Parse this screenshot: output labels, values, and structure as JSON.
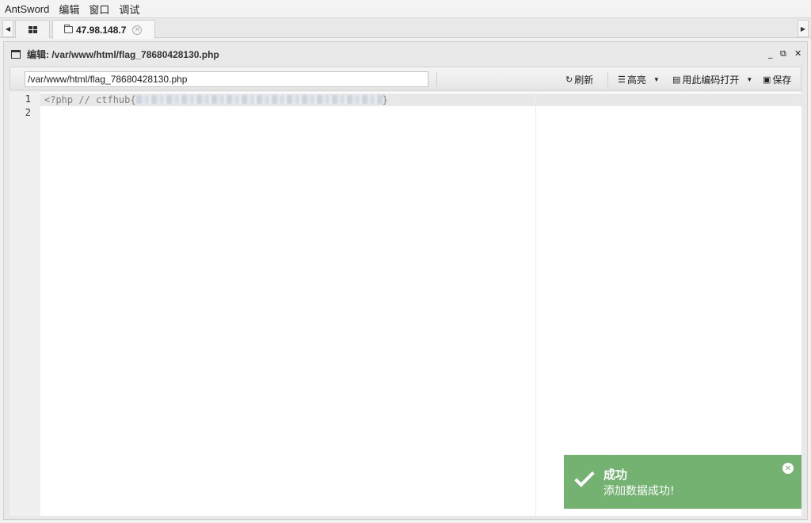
{
  "menubar": {
    "items": [
      "AntSword",
      "编辑",
      "窗口",
      "调试"
    ]
  },
  "tabs": {
    "host_tab": {
      "label": "47.98.148.7"
    }
  },
  "window": {
    "title": "编辑: /var/www/html/flag_78680428130.php",
    "controls": {
      "minimize": "_",
      "restore": "⧉",
      "close": "✕"
    }
  },
  "toolbar": {
    "path_value": "/var/www/html/flag_78680428130.php",
    "refresh_label": "刷新",
    "highlight_label": "高亮",
    "encoding_label": "用此编码打开",
    "save_label": "保存"
  },
  "editor": {
    "line_numbers": [
      "1",
      "2"
    ],
    "line1_text": "<?php // ctfhub{",
    "line1_end": "}"
  },
  "toast": {
    "title": "成功",
    "message": "添加数据成功!",
    "color": "#74b272"
  }
}
